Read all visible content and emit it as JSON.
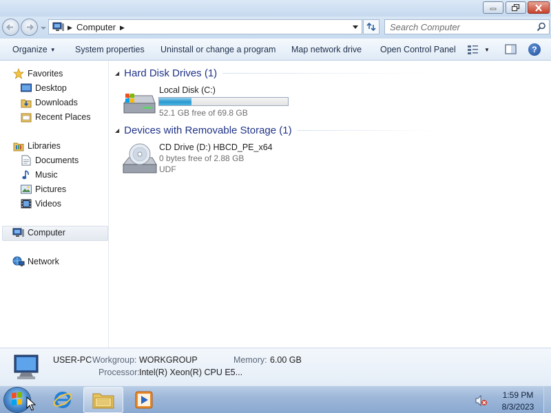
{
  "window": {
    "address": {
      "path_item": "Computer"
    },
    "search": {
      "placeholder": "Search Computer"
    }
  },
  "toolbar": {
    "organize": "Organize",
    "system_properties": "System properties",
    "uninstall": "Uninstall or change a program",
    "map_drive": "Map network drive",
    "control_panel": "Open Control Panel"
  },
  "sidebar": {
    "favorites": "Favorites",
    "desktop": "Desktop",
    "downloads": "Downloads",
    "recent_places": "Recent Places",
    "libraries": "Libraries",
    "documents": "Documents",
    "music": "Music",
    "pictures": "Pictures",
    "videos": "Videos",
    "computer": "Computer",
    "network": "Network"
  },
  "content": {
    "hdd_group": "Hard Disk Drives (1)",
    "removable_group": "Devices with Removable Storage (1)",
    "local_disk": {
      "name": "Local Disk (C:)",
      "free_text": "52.1 GB free of 69.8 GB",
      "used_fraction": 0.254
    },
    "cd_drive": {
      "name": "CD Drive (D:) HBCD_PE_x64",
      "free_text": "0 bytes free of 2.88 GB",
      "fs": "UDF"
    }
  },
  "details": {
    "computer_name": "USER-PC",
    "workgroup_label": "Workgroup:",
    "workgroup_value": "WORKGROUP",
    "memory_label": "Memory:",
    "memory_value": "6.00 GB",
    "processor_label": "Processor:",
    "processor_value": "Intel(R) Xeon(R) CPU E5..."
  },
  "taskbar": {
    "time": "1:59 PM",
    "date": "8/3/2023"
  },
  "colors": {
    "group_title": "#1e3287",
    "capacity_bar": "#2a98cf"
  }
}
